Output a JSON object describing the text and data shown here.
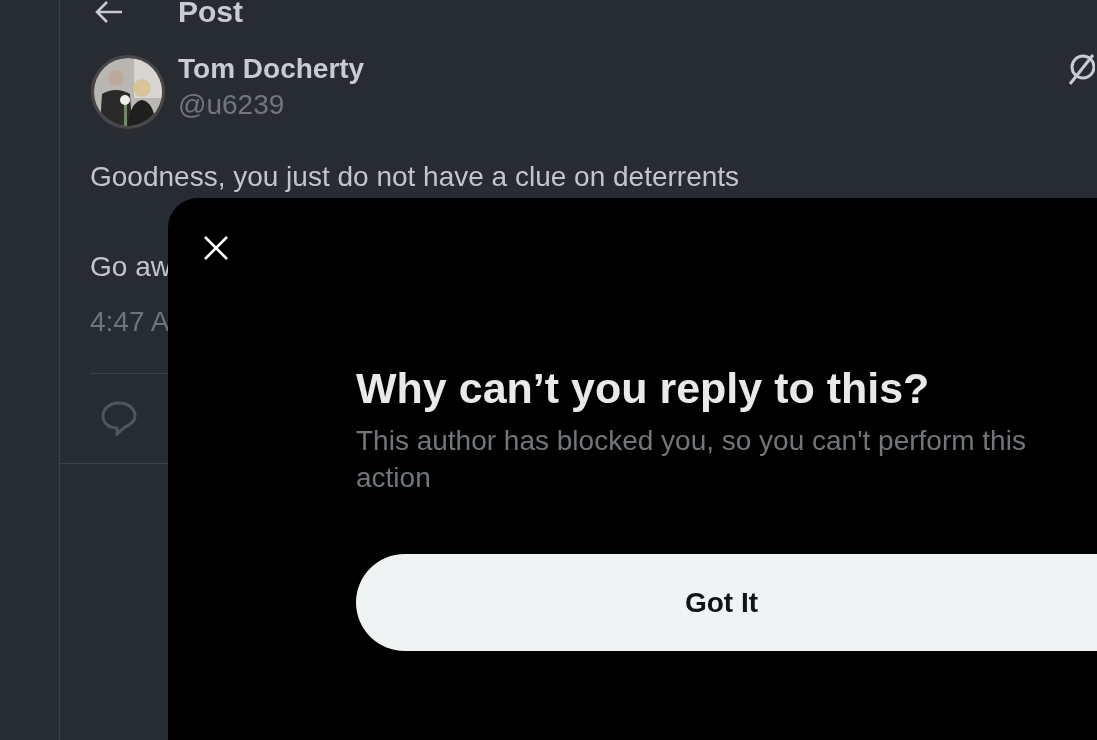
{
  "header": {
    "title": "Post"
  },
  "post": {
    "author": {
      "name": "Tom Docherty",
      "handle": "@u6239"
    },
    "lines": [
      "Goodness, you just do not have a clue on deterrents",
      "Go aw"
    ],
    "time": "4:47 A"
  },
  "dialog": {
    "title": "Why can’t you reply to this?",
    "message": "This author has blocked you, so you can't perform this action",
    "button": "Got It"
  }
}
